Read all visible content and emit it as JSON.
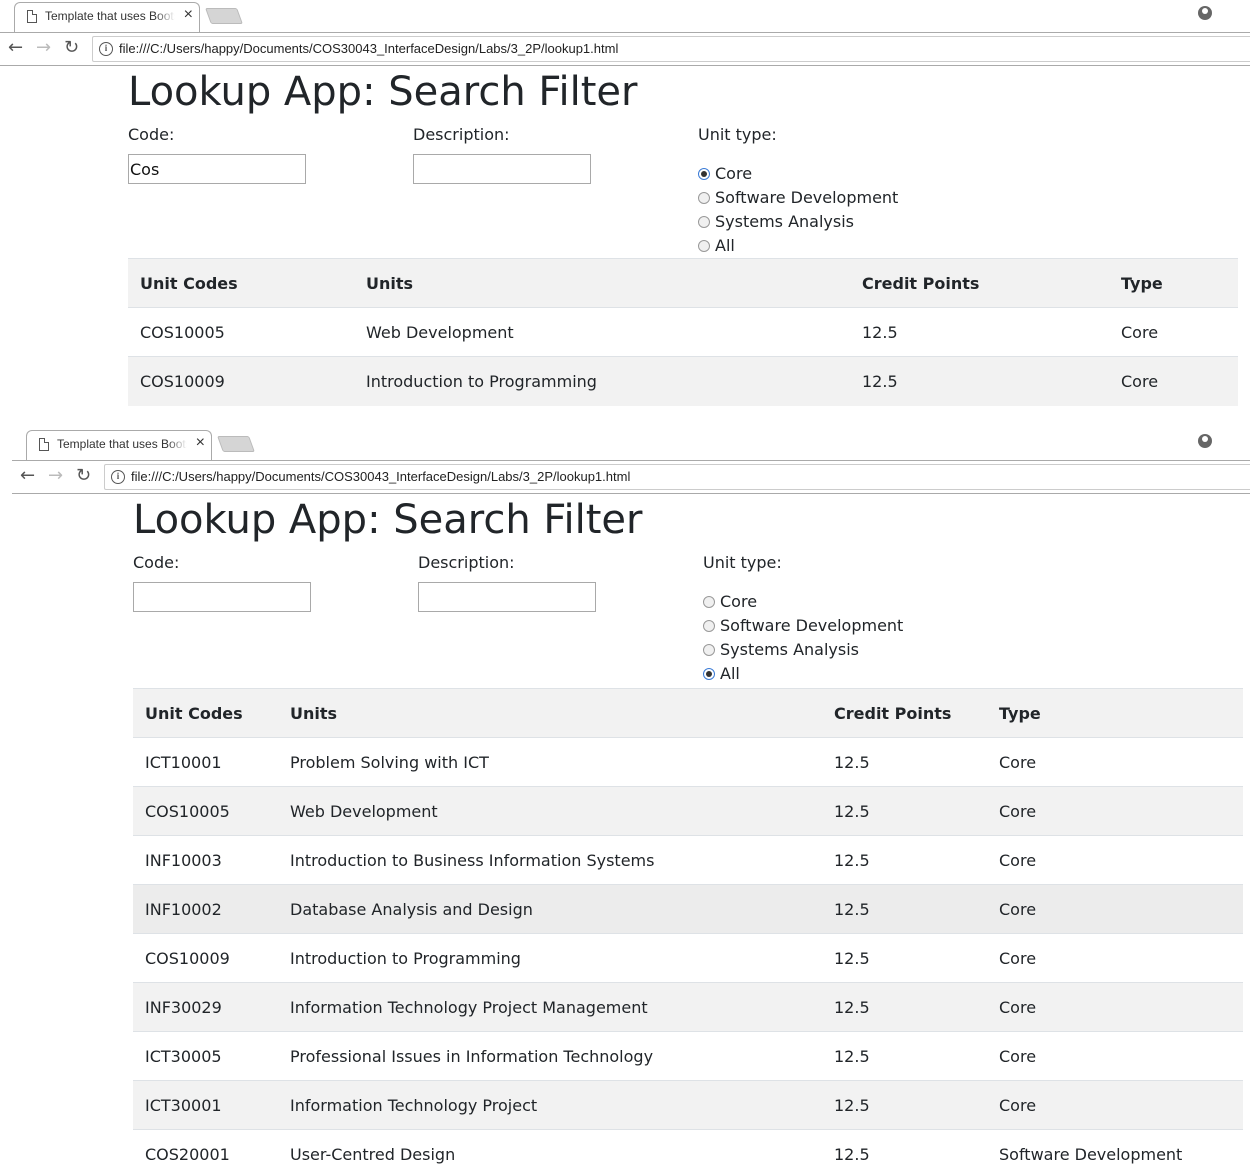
{
  "browser": {
    "tab_title": "Template that uses Bootstrap",
    "close_glyph": "×",
    "url": "file:///C:/Users/happy/Documents/COS30043_InterfaceDesign/Labs/3_2P/lookup1.html",
    "back_glyph": "←",
    "forward_glyph": "→",
    "reload_glyph": "↻",
    "info_glyph": "i"
  },
  "app": {
    "title": "Lookup App: Search Filter",
    "code_label": "Code:",
    "description_label": "Description:",
    "unit_type_label": "Unit type:",
    "radio_options": [
      "Core",
      "Software Development",
      "Systems Analysis",
      "All"
    ],
    "columns": [
      "Unit Codes",
      "Units",
      "Credit Points",
      "Type"
    ]
  },
  "shot1": {
    "code_value": "Cos",
    "description_value": "",
    "selected_type": "Core",
    "rows": [
      {
        "code": "COS10005",
        "unit": "Web Development",
        "credit": "12.5",
        "type": "Core"
      },
      {
        "code": "COS10009",
        "unit": "Introduction to Programming",
        "credit": "12.5",
        "type": "Core"
      }
    ]
  },
  "shot2": {
    "code_value": "",
    "description_value": "",
    "selected_type": "All",
    "rows": [
      {
        "code": "ICT10001",
        "unit": "Problem Solving with ICT",
        "credit": "12.5",
        "type": "Core"
      },
      {
        "code": "COS10005",
        "unit": "Web Development",
        "credit": "12.5",
        "type": "Core"
      },
      {
        "code": "INF10003",
        "unit": "Introduction to Business Information Systems",
        "credit": "12.5",
        "type": "Core"
      },
      {
        "code": "INF10002",
        "unit": "Database Analysis and Design",
        "credit": "12.5",
        "type": "Core"
      },
      {
        "code": "COS10009",
        "unit": "Introduction to Programming",
        "credit": "12.5",
        "type": "Core"
      },
      {
        "code": "INF30029",
        "unit": "Information Technology Project Management",
        "credit": "12.5",
        "type": "Core"
      },
      {
        "code": "ICT30005",
        "unit": "Professional Issues in Information Technology",
        "credit": "12.5",
        "type": "Core"
      },
      {
        "code": "ICT30001",
        "unit": "Information Technology Project",
        "credit": "12.5",
        "type": "Core"
      },
      {
        "code": "COS20001",
        "unit": "User-Centred Design",
        "credit": "12.5",
        "type": "Software Development"
      }
    ]
  }
}
